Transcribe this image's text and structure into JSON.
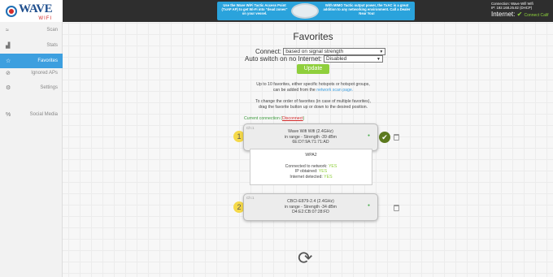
{
  "brand": {
    "name": "WAVE",
    "sub": "WIFI"
  },
  "promo": {
    "left_text": "Use the Wave WiFi Tactic Access Point (TxAP AP) to get Wi-Fi into \"dead zones\" on your vessel.",
    "right_text": "With MIMO Tactic output power, the TxAC is a great addition to any networking environment. Call a Dealer Near You!"
  },
  "status": {
    "connection": "Connection: Wave Wifi Wifi",
    "ip": "IP: 192.168.25.82 (DHCP)",
    "internet_label": "Internet:",
    "internet_value": "Connect Calif"
  },
  "sidebar": {
    "items": [
      {
        "label": "Scan",
        "icon": "wifi-icon"
      },
      {
        "label": "Stats",
        "icon": "chart-icon"
      },
      {
        "label": "Favorites",
        "icon": "star-icon"
      },
      {
        "label": "Ignored APs",
        "icon": "block-icon"
      },
      {
        "label": "Settings",
        "icon": "gear-icon"
      },
      {
        "label": "Social Media",
        "icon": "share-icon"
      }
    ],
    "active_color": "#3d9fdf"
  },
  "main": {
    "title": "Favorites",
    "connect_label": "Connect:",
    "connect_value": "based on signal strength",
    "auto_label": "Auto switch on no Internet:",
    "auto_value": "Disabled",
    "update_label": "Update",
    "info1_a": "Up to 10 favorites, either specific hotspots or hotspot groups,",
    "info1_b": "can be added from the",
    "info1_link": "network scan page.",
    "info2_a": "To change the order of favorites (in case of multiple favorites),",
    "info2_b": "drag the favorite button up or down to the desired position.",
    "current_label": "Current connection (",
    "disconnect": "Disconnect",
    "current_close": ")"
  },
  "favorites": [
    {
      "number": "1",
      "channel": "Ch:1",
      "name": "Wave Wifi Wifi (2.4GHz)",
      "signal": "in range - Strength -39 dBm",
      "mac": "6E:D7:9A:71:71:AD"
    },
    {
      "number": "2",
      "channel": "Ch:1",
      "name": "CBCI-E879-2.4 (2.4GHz)",
      "signal": "in range - Strength -34 dBm",
      "mac": "D4:E2:CB:07:28:FD"
    }
  ],
  "details": {
    "security": "WPA2",
    "connected_label": "Connected to network:",
    "ip_label": "IP obtained:",
    "internet_label": "Internet detected:",
    "yes": "YES"
  },
  "colors": {
    "accent": "#3d9fdf",
    "green": "#8fcf3c",
    "badge": "#f5d94a"
  }
}
